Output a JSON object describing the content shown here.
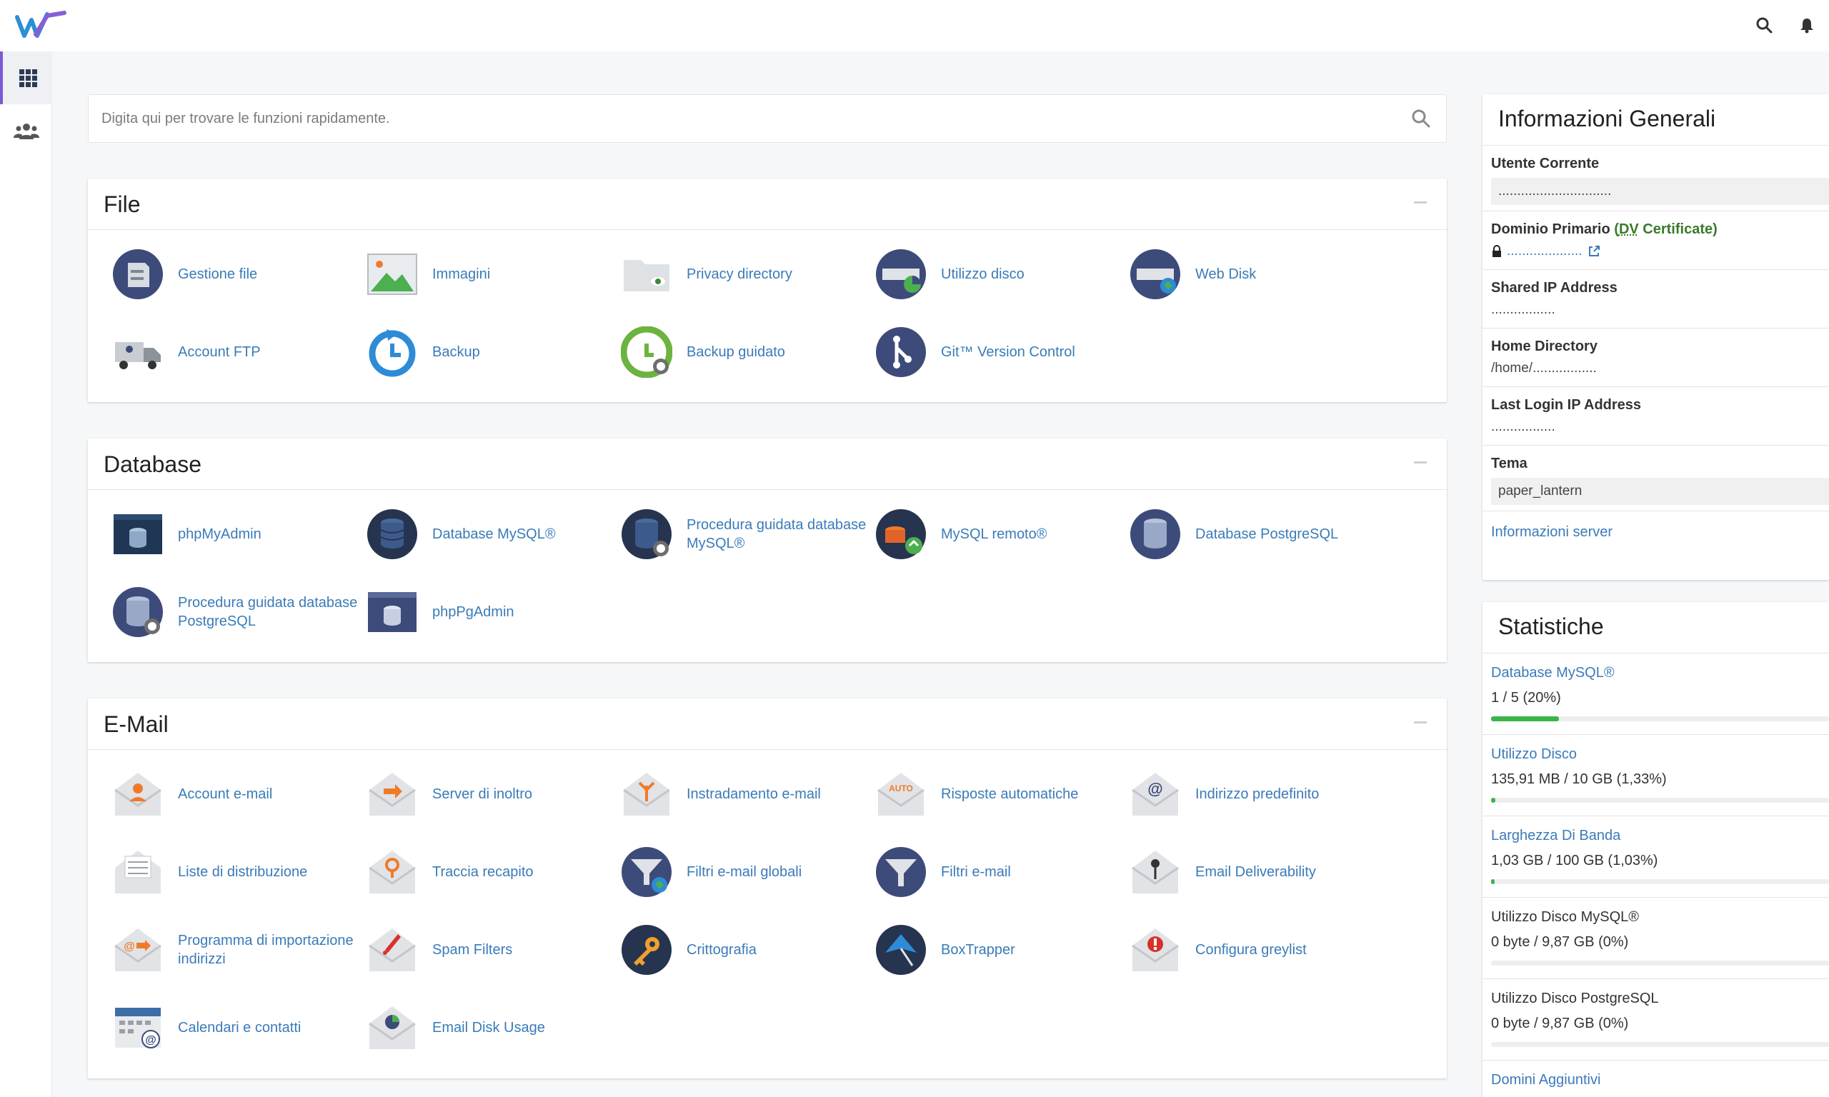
{
  "header": {
    "logo_icon": "whm-logo",
    "search_icon": "search-icon",
    "bell_icon": "bell-icon"
  },
  "sidebar": {
    "items": [
      {
        "name": "tools",
        "icon": "grid-icon",
        "active": true
      },
      {
        "name": "users",
        "icon": "users-icon",
        "active": false
      }
    ]
  },
  "search": {
    "placeholder": "Digita qui per trovare le funzioni rapidamente."
  },
  "sections": [
    {
      "title": "File",
      "items": [
        {
          "label": "Gestione file",
          "icon": "file-manager-icon"
        },
        {
          "label": "Immagini",
          "icon": "images-icon"
        },
        {
          "label": "Privacy directory",
          "icon": "directory-privacy-icon"
        },
        {
          "label": "Utilizzo disco",
          "icon": "disk-usage-icon"
        },
        {
          "label": "Web Disk",
          "icon": "web-disk-icon"
        },
        {
          "label": "Account FTP",
          "icon": "ftp-accounts-icon"
        },
        {
          "label": "Backup",
          "icon": "backup-icon"
        },
        {
          "label": "Backup guidato",
          "icon": "backup-wizard-icon"
        },
        {
          "label": "Git™ Version Control",
          "icon": "git-icon"
        }
      ]
    },
    {
      "title": "Database",
      "items": [
        {
          "label": "phpMyAdmin",
          "icon": "phpmyadmin-icon"
        },
        {
          "label": "Database MySQL®",
          "icon": "mysql-databases-icon"
        },
        {
          "label": "Procedura guidata database MySQL®",
          "icon": "mysql-wizard-icon"
        },
        {
          "label": "MySQL remoto®",
          "icon": "remote-mysql-icon"
        },
        {
          "label": "Database PostgreSQL",
          "icon": "postgresql-databases-icon"
        },
        {
          "label": "Procedura guidata database PostgreSQL",
          "icon": "postgresql-wizard-icon"
        },
        {
          "label": "phpPgAdmin",
          "icon": "phppgadmin-icon"
        }
      ]
    },
    {
      "title": "E-Mail",
      "items": [
        {
          "label": "Account e-mail",
          "icon": "email-accounts-icon"
        },
        {
          "label": "Server di inoltro",
          "icon": "forwarders-icon"
        },
        {
          "label": "Instradamento e-mail",
          "icon": "email-routing-icon"
        },
        {
          "label": "Risposte automatiche",
          "icon": "autoresponders-icon"
        },
        {
          "label": "Indirizzo predefinito",
          "icon": "default-address-icon"
        },
        {
          "label": "Liste di distribuzione",
          "icon": "mailing-lists-icon"
        },
        {
          "label": "Traccia recapito",
          "icon": "track-delivery-icon"
        },
        {
          "label": "Filtri e-mail globali",
          "icon": "global-filters-icon"
        },
        {
          "label": "Filtri e-mail",
          "icon": "email-filters-icon"
        },
        {
          "label": "Email Deliverability",
          "icon": "email-deliverability-icon"
        },
        {
          "label": "Programma di importazione indirizzi",
          "icon": "address-importer-icon"
        },
        {
          "label": "Spam Filters",
          "icon": "spam-filters-icon"
        },
        {
          "label": "Crittografia",
          "icon": "encryption-icon"
        },
        {
          "label": "BoxTrapper",
          "icon": "boxtrapper-icon"
        },
        {
          "label": "Configura greylist",
          "icon": "greylisting-icon"
        },
        {
          "label": "Calendari e contatti",
          "icon": "calendars-icon"
        },
        {
          "label": "Email Disk Usage",
          "icon": "email-disk-usage-icon"
        }
      ]
    }
  ],
  "general_info": {
    "title": "Informazioni Generali",
    "current_user_label": "Utente Corrente",
    "current_user_value": "..............................",
    "primary_domain_label": "Dominio Primario",
    "cert_open": "(",
    "cert_dv": "DV",
    "cert_rest": " Certificate)",
    "primary_domain_value": "....................",
    "shared_ip_label": "Shared IP Address",
    "shared_ip_value": ".................",
    "home_dir_label": "Home Directory",
    "home_dir_value": "/home/.................",
    "last_login_label": "Last Login IP Address",
    "last_login_value": ".................",
    "theme_label": "Tema",
    "theme_value": "paper_lantern",
    "server_info_link": "Informazioni server"
  },
  "stats": {
    "title": "Statistiche",
    "items": [
      {
        "label": "Database MySQL®",
        "value": "1 / 5   (20%)",
        "percent": 20,
        "link": true
      },
      {
        "label": "Utilizzo Disco",
        "value": "135,91 MB / 10 GB   (1,33%)",
        "percent": 1.33,
        "link": true
      },
      {
        "label": "Larghezza Di Banda",
        "value": "1,03 GB / 100 GB   (1,03%)",
        "percent": 1.03,
        "link": true
      },
      {
        "label": "Utilizzo Disco MySQL®",
        "value": "0 byte / 9,87 GB   (0%)",
        "percent": 0,
        "link": false
      },
      {
        "label": "Utilizzo Disco PostgreSQL",
        "value": "0 byte / 9,87 GB   (0%)",
        "percent": 0,
        "link": false
      },
      {
        "label": "Domini Aggiuntivi",
        "value": "",
        "percent": null,
        "link": true
      }
    ]
  }
}
